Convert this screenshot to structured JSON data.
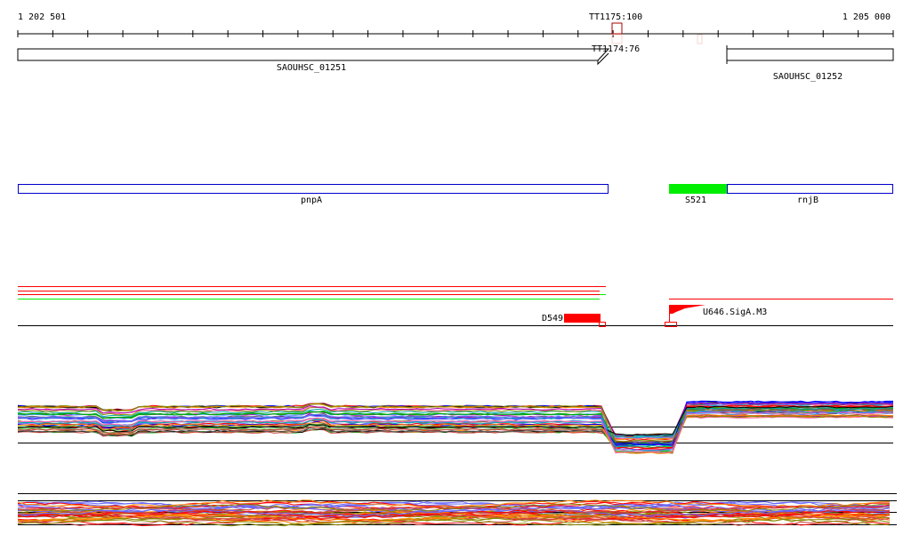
{
  "axis": {
    "start_label": "1 202 501",
    "end_label": "1 205 000",
    "tick_count": 26
  },
  "terminators": [
    {
      "label": "TT1175:100",
      "color": "#aa0000"
    },
    {
      "label": "TT1174:76",
      "color": "#000000"
    }
  ],
  "genes_top": [
    {
      "label": "SAOUHSC_01251",
      "strand": "+"
    },
    {
      "label": "SAOUHSC_01252",
      "strand": "-"
    }
  ],
  "genes_annot": [
    {
      "label": "pnpA",
      "color": "#0000cc"
    },
    {
      "label": "S521",
      "color": "#00ee00"
    },
    {
      "label": "rnjB",
      "color": "#0000cc"
    }
  ],
  "features": [
    {
      "label": "D549",
      "color": "#ff0000"
    },
    {
      "label": "U646.SigA.M3",
      "color": "#ff0000"
    }
  ],
  "colors": {
    "red": "#ff0000",
    "green": "#00ee00",
    "blue": "#0000cc"
  },
  "expression_palette": [
    "#ff0000",
    "#00aa00",
    "#0000ff",
    "#ff8800",
    "#aa00aa",
    "#00aaaa",
    "#888800",
    "#000000",
    "#ff66aa",
    "#6666ff",
    "#996633",
    "#44cc44",
    "#cc4444",
    "#3399ff",
    "#666666"
  ]
}
